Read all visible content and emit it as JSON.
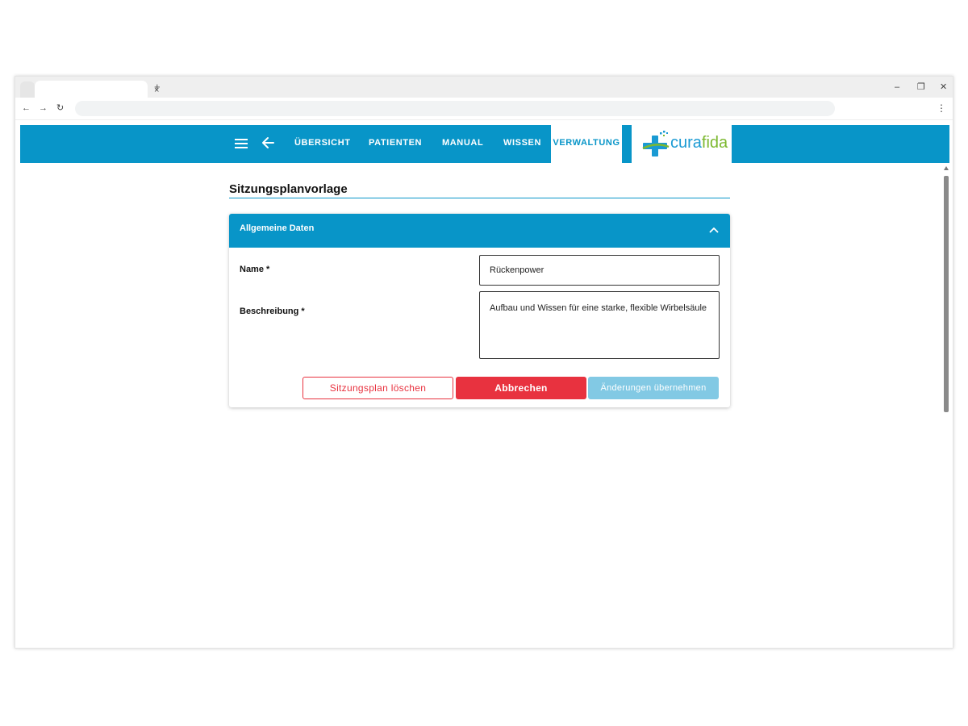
{
  "browser": {
    "tab_close": "×",
    "tab_new": "+",
    "minimize": "–",
    "restore": "❐",
    "close": "✕",
    "back": "←",
    "forward": "→",
    "reload": "↻",
    "menu": "⋮"
  },
  "header": {
    "nav": [
      "ÜBERSICHT",
      "PATIENTEN",
      "MANUAL",
      "WISSEN",
      "VERWALTUNG"
    ],
    "active_nav": "VERWALTUNG",
    "logo": {
      "part1": "cura",
      "part2": "fida"
    },
    "colors": {
      "primary": "#0895c8",
      "logo_blue": "#1a9ad3",
      "logo_green": "#7cb82f"
    }
  },
  "page": {
    "title": "Sitzungsplanvorlage"
  },
  "card": {
    "title": "Allgemeine Daten",
    "fields": {
      "name_label": "Name *",
      "name_value": "Rückenpower",
      "description_label": "Beschreibung *",
      "description_value": "Aufbau und Wissen für eine starke, flexible Wirbelsäule"
    },
    "buttons": {
      "delete": "Sitzungsplan löschen",
      "cancel": "Abbrechen",
      "apply": "Änderungen übernehmen"
    },
    "colors": {
      "danger": "#e8323f",
      "disabled": "#82c9e4"
    }
  }
}
